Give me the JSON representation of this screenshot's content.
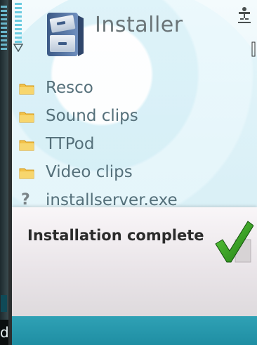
{
  "app": {
    "title": "Installer",
    "icon": "installer-app-icon"
  },
  "status": {
    "signal_icon": "signal-strength-icon",
    "antenna_icon": "antenna-icon",
    "connectivity_icon": "connectivity-icon",
    "battery_icon": "battery-icon"
  },
  "file_list": {
    "items": [
      {
        "label": "Resco",
        "icon": "folder-icon"
      },
      {
        "label": "Sound clips",
        "icon": "folder-icon"
      },
      {
        "label": "TTPod",
        "icon": "folder-icon"
      },
      {
        "label": "Video clips",
        "icon": "folder-icon"
      },
      {
        "label": "installserver.exe",
        "icon": "unknown-file-icon"
      }
    ]
  },
  "popup": {
    "message": "Installation complete",
    "icon": "checkmark-icon"
  },
  "left_edge": {
    "partial_text": "d"
  },
  "colors": {
    "accent": "#2fa1b5",
    "folder": "#f2c24a",
    "check": "#2e8b1f",
    "title_text": "#6a7477",
    "list_text": "#55707a"
  }
}
